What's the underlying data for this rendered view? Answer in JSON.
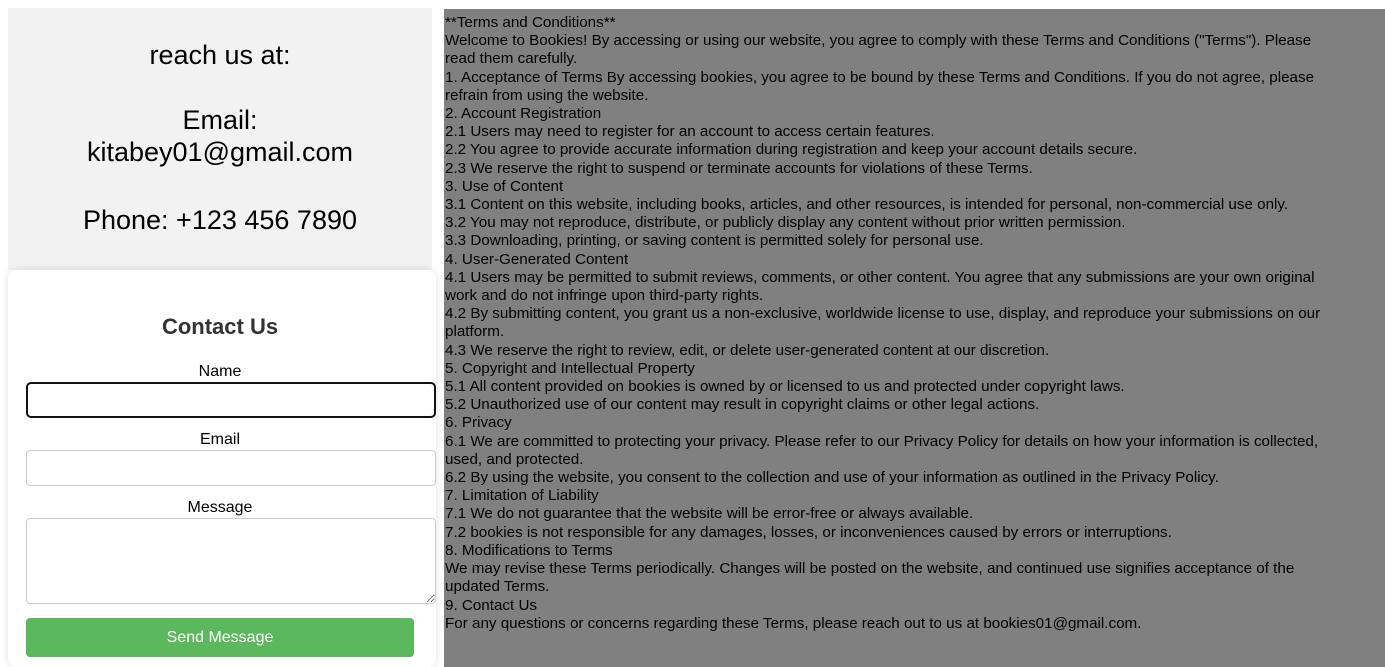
{
  "reach": {
    "title": "reach us at:",
    "email_line1": "Email:",
    "email_line2": "kitabey01@gmail.com",
    "phone": "Phone: +123 456 7890"
  },
  "contact_form": {
    "title": "Contact Us",
    "name_label": "Name",
    "name_value": "",
    "email_label": "Email",
    "email_value": "",
    "message_label": "Message",
    "message_value": "",
    "send_label": "Send Message",
    "button_color": "#5cb85c"
  },
  "terms": {
    "background": "#808080",
    "lines": [
      "**Terms and Conditions**",
      "Welcome to Bookies! By accessing or using our website, you agree to comply with these Terms and Conditions (\"Terms\"). Please",
      "read them carefully.",
      "1. Acceptance of Terms By accessing bookies, you agree to be bound by these Terms and Conditions. If you do not agree, please",
      "refrain from using the website.",
      "2. Account Registration",
      "2.1 Users may need to register for an account to access certain features.",
      "2.2 You agree to provide accurate information during registration and keep your account details secure.",
      "2.3 We reserve the right to suspend or terminate accounts for violations of these Terms.",
      "3. Use of Content",
      "3.1 Content on this website, including books, articles, and other resources, is intended for personal, non-commercial use only.",
      "3.2 You may not reproduce, distribute, or publicly display any content without prior written permission.",
      "3.3 Downloading, printing, or saving content is permitted solely for personal use.",
      "4. User-Generated Content",
      "4.1 Users may be permitted to submit reviews, comments, or other content. You agree that any submissions are your own original",
      "work and do not infringe upon third-party rights.",
      "4.2 By submitting content, you grant us a non-exclusive, worldwide license to use, display, and reproduce your submissions on our",
      "platform.",
      "4.3 We reserve the right to review, edit, or delete user-generated content at our discretion.",
      "5. Copyright and Intellectual Property",
      "5.1 All content provided on bookies is owned by or licensed to us and protected under copyright laws.",
      "5.2 Unauthorized use of our content may result in copyright claims or other legal actions.",
      "6. Privacy",
      "6.1 We are committed to protecting your privacy. Please refer to our Privacy Policy for details on how your information is collected,",
      "used, and protected.",
      "6.2 By using the website, you consent to the collection and use of your information as outlined in the Privacy Policy.",
      "7. Limitation of Liability",
      "7.1 We do not guarantee that the website will be error-free or always available.",
      "7.2 bookies is not responsible for any damages, losses, or inconveniences caused by errors or interruptions.",
      "8. Modifications to Terms",
      "We may revise these Terms periodically. Changes will be posted on the website, and continued use signifies acceptance of the",
      "updated Terms.",
      "9. Contact Us",
      "For any questions or concerns regarding these Terms, please reach out to us at bookies01@gmail.com."
    ]
  }
}
